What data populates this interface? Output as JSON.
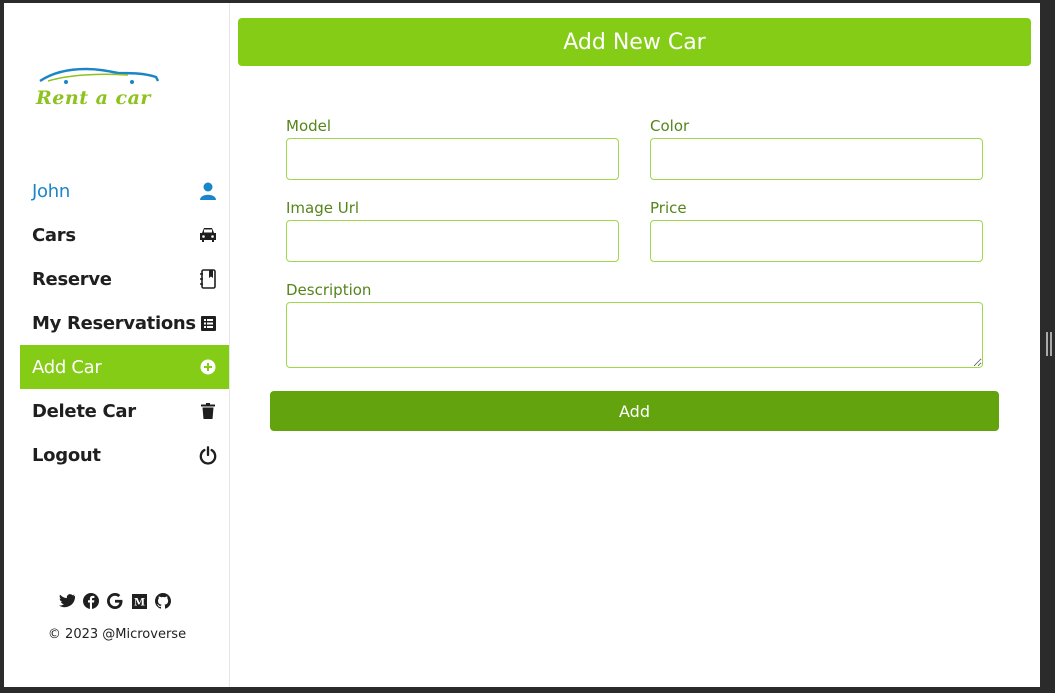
{
  "brand": {
    "name": "Rent a car",
    "color": "#8dc21f",
    "car_color": "#1a86c7"
  },
  "nav": {
    "user": {
      "label": "John",
      "icon": "user-icon"
    },
    "items": [
      {
        "label": "Cars",
        "icon": "car-icon"
      },
      {
        "label": "Reserve",
        "icon": "notebook-icon"
      },
      {
        "label": "My Reservations",
        "icon": "list-icon"
      },
      {
        "label": "Add Car",
        "icon": "plus-circle-icon",
        "active": true
      },
      {
        "label": "Delete Car",
        "icon": "trash-icon"
      },
      {
        "label": "Logout",
        "icon": "power-icon"
      }
    ]
  },
  "socials": [
    "twitter-icon",
    "facebook-icon",
    "google-icon",
    "medium-icon",
    "github-icon"
  ],
  "footer": {
    "copyright": "© 2023 @Microverse"
  },
  "form": {
    "title": "Add New Car",
    "model_label": "Model",
    "model_value": "",
    "color_label": "Color",
    "color_value": "",
    "image_label": "Image Url",
    "image_value": "",
    "price_label": "Price",
    "price_value": "",
    "description_label": "Description",
    "description_value": "",
    "submit_label": "Add"
  },
  "colors": {
    "accent": "#84cc16",
    "button": "#62a30e",
    "label": "#55851a",
    "link": "#1a86c7"
  }
}
